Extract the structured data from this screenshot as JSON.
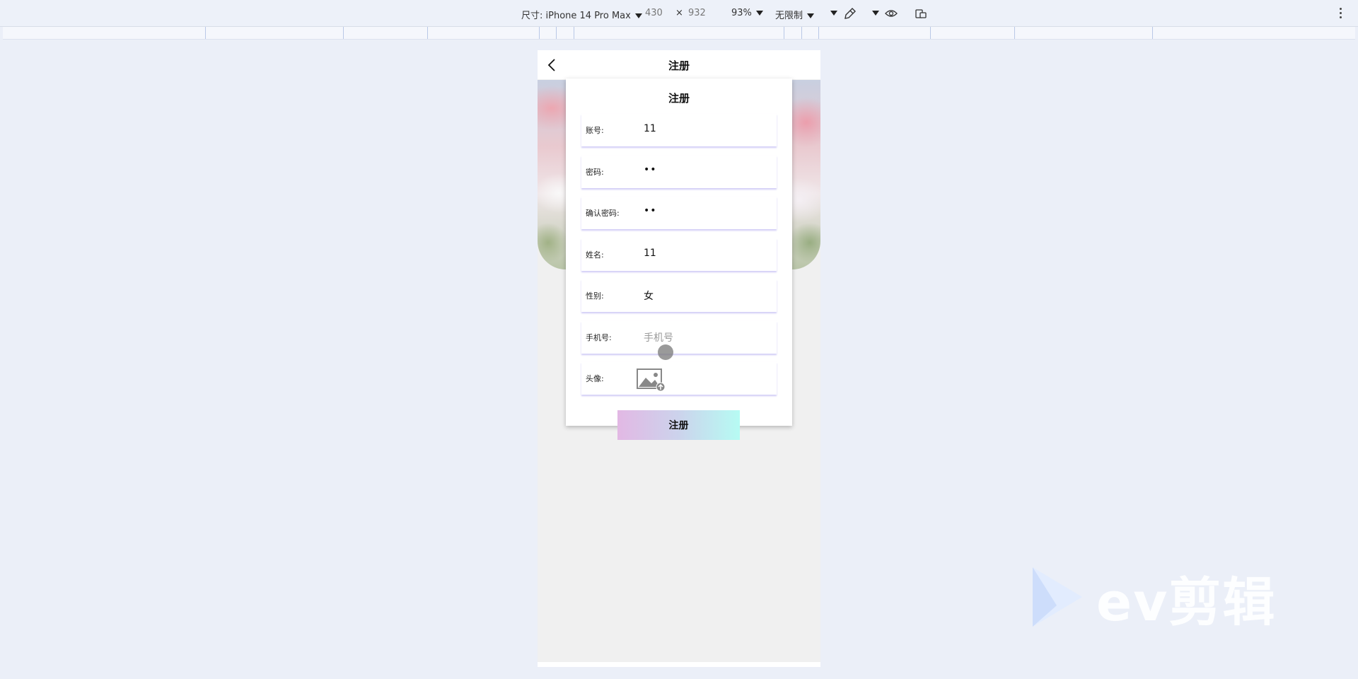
{
  "toolbar": {
    "dimensions_label": "尺寸: iPhone 14 Pro Max",
    "width": "430",
    "times": "×",
    "height": "932",
    "zoom": "93%",
    "throttle": "无限制"
  },
  "app": {
    "header_title": "注册",
    "form_title": "注册",
    "fields": [
      {
        "label": "账号:",
        "value": "11"
      },
      {
        "label": "密码:",
        "value": "••"
      },
      {
        "label": "确认密码:",
        "value": "••"
      },
      {
        "label": "姓名:",
        "value": "11"
      },
      {
        "label": "性别:",
        "value": "女"
      },
      {
        "label": "手机号:",
        "placeholder": "手机号"
      },
      {
        "label": "头像:"
      }
    ],
    "register_button": "注册"
  },
  "watermark": {
    "text": "ev剪辑"
  },
  "colors": {
    "page_bg": "#ebeff8",
    "button_gradient_start": "#e2b8e4",
    "button_gradient_end": "#b6fbf3",
    "field_shadow": "#968ceb"
  },
  "icons": [
    "chevron-down-icon",
    "eyedropper-icon",
    "eye-icon",
    "rotate-device-icon",
    "more-vert-icon",
    "back-icon",
    "image-upload-icon"
  ]
}
